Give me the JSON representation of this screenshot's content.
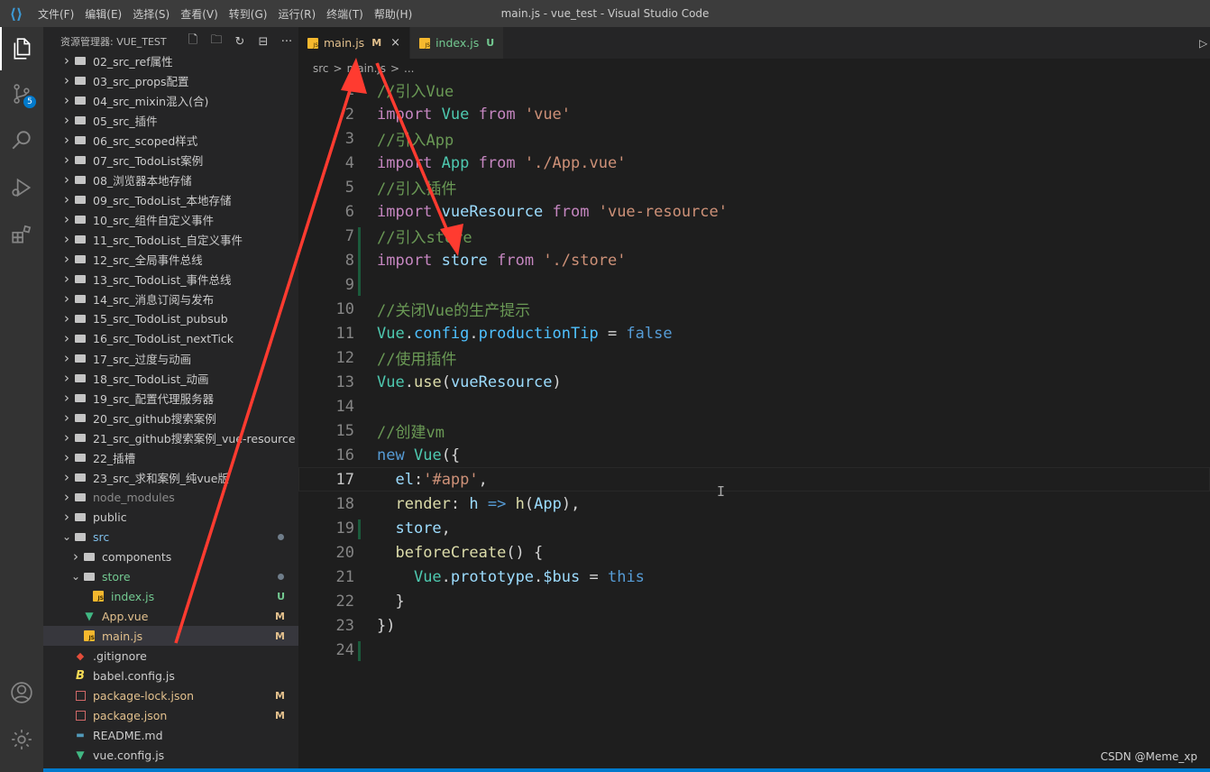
{
  "window": {
    "title": "main.js - vue_test - Visual Studio Code",
    "menu": [
      "文件(F)",
      "编辑(E)",
      "选择(S)",
      "查看(V)",
      "转到(G)",
      "运行(R)",
      "终端(T)",
      "帮助(H)"
    ]
  },
  "activity": {
    "scm_badge": "5",
    "icons": [
      "explorer-icon",
      "source-control-icon",
      "search-icon",
      "run-debug-icon",
      "extensions-icon",
      "account-icon",
      "settings-gear-icon"
    ]
  },
  "sidebar": {
    "title": "资源管理器: VUE_TEST",
    "tools": [
      "new-file-icon",
      "new-folder-icon",
      "refresh-icon",
      "collapse-all-icon",
      "more-icon"
    ],
    "items": [
      {
        "label": "02_src_ref属性",
        "kind": "folder",
        "depth": 0,
        "expanded": false
      },
      {
        "label": "03_src_props配置",
        "kind": "folder",
        "depth": 0,
        "expanded": false
      },
      {
        "label": "04_src_mixin混入(合)",
        "kind": "folder",
        "depth": 0,
        "expanded": false
      },
      {
        "label": "05_src_插件",
        "kind": "folder",
        "depth": 0,
        "expanded": false
      },
      {
        "label": "06_src_scoped样式",
        "kind": "folder",
        "depth": 0,
        "expanded": false
      },
      {
        "label": "07_src_TodoList案例",
        "kind": "folder",
        "depth": 0,
        "expanded": false
      },
      {
        "label": "08_浏览器本地存储",
        "kind": "folder",
        "depth": 0,
        "expanded": false
      },
      {
        "label": "09_src_TodoList_本地存储",
        "kind": "folder",
        "depth": 0,
        "expanded": false
      },
      {
        "label": "10_src_组件自定义事件",
        "kind": "folder",
        "depth": 0,
        "expanded": false
      },
      {
        "label": "11_src_TodoList_自定义事件",
        "kind": "folder",
        "depth": 0,
        "expanded": false
      },
      {
        "label": "12_src_全局事件总线",
        "kind": "folder",
        "depth": 0,
        "expanded": false
      },
      {
        "label": "13_src_TodoList_事件总线",
        "kind": "folder",
        "depth": 0,
        "expanded": false
      },
      {
        "label": "14_src_消息订阅与发布",
        "kind": "folder",
        "depth": 0,
        "expanded": false
      },
      {
        "label": "15_src_TodoList_pubsub",
        "kind": "folder",
        "depth": 0,
        "expanded": false
      },
      {
        "label": "16_src_TodoList_nextTick",
        "kind": "folder",
        "depth": 0,
        "expanded": false
      },
      {
        "label": "17_src_过度与动画",
        "kind": "folder",
        "depth": 0,
        "expanded": false
      },
      {
        "label": "18_src_TodoList_动画",
        "kind": "folder",
        "depth": 0,
        "expanded": false
      },
      {
        "label": "19_src_配置代理服务器",
        "kind": "folder",
        "depth": 0,
        "expanded": false
      },
      {
        "label": "20_src_github搜索案例",
        "kind": "folder",
        "depth": 0,
        "expanded": false
      },
      {
        "label": "21_src_github搜索案例_vue-resource",
        "kind": "folder",
        "depth": 0,
        "expanded": false
      },
      {
        "label": "22_插槽",
        "kind": "folder",
        "depth": 0,
        "expanded": false
      },
      {
        "label": "23_src_求和案例_纯vue版",
        "kind": "folder",
        "depth": 0,
        "expanded": false
      },
      {
        "label": "node_modules",
        "kind": "folder",
        "depth": 0,
        "expanded": false,
        "dim": true
      },
      {
        "label": "public",
        "kind": "folder",
        "depth": 0,
        "expanded": false
      },
      {
        "label": "src",
        "kind": "folder",
        "depth": 0,
        "expanded": true,
        "dot": true,
        "blue": true
      },
      {
        "label": "components",
        "kind": "folder",
        "depth": 1,
        "expanded": false
      },
      {
        "label": "store",
        "kind": "folder",
        "depth": 1,
        "expanded": true,
        "dot": true,
        "new": true
      },
      {
        "label": "index.js",
        "kind": "js",
        "depth": 2,
        "status": "U"
      },
      {
        "label": "App.vue",
        "kind": "vue",
        "depth": 1,
        "status": "M"
      },
      {
        "label": "main.js",
        "kind": "js",
        "depth": 1,
        "status": "M",
        "selected": true
      },
      {
        "label": ".gitignore",
        "kind": "git",
        "depth": 0
      },
      {
        "label": "babel.config.js",
        "kind": "babel",
        "depth": 0
      },
      {
        "label": "package-lock.json",
        "kind": "json",
        "depth": 0,
        "status": "M"
      },
      {
        "label": "package.json",
        "kind": "json",
        "depth": 0,
        "status": "M"
      },
      {
        "label": "README.md",
        "kind": "md",
        "depth": 0
      },
      {
        "label": "vue.config.js",
        "kind": "vue",
        "depth": 0
      }
    ]
  },
  "tabs": [
    {
      "label": "main.js",
      "status": "M",
      "active": true,
      "close": "×"
    },
    {
      "label": "index.js",
      "status": "U",
      "active": false
    }
  ],
  "breadcrumb": [
    "src",
    ">",
    "main.js",
    ">",
    "..."
  ],
  "editor": {
    "current_line": 17,
    "lines": [
      {
        "n": 1,
        "tokens": [
          [
            "cm",
            "//引入Vue"
          ]
        ]
      },
      {
        "n": 2,
        "tokens": [
          [
            "kw",
            "import"
          ],
          [
            "",
            " "
          ],
          [
            "cls",
            "Vue"
          ],
          [
            "",
            " "
          ],
          [
            "kw",
            "from"
          ],
          [
            "",
            " "
          ],
          [
            "str",
            "'vue'"
          ]
        ]
      },
      {
        "n": 3,
        "tokens": [
          [
            "cm",
            "//引入App"
          ]
        ]
      },
      {
        "n": 4,
        "tokens": [
          [
            "kw",
            "import"
          ],
          [
            "",
            " "
          ],
          [
            "cls",
            "App"
          ],
          [
            "",
            " "
          ],
          [
            "kw",
            "from"
          ],
          [
            "",
            " "
          ],
          [
            "str",
            "'./App.vue'"
          ]
        ]
      },
      {
        "n": 5,
        "tokens": [
          [
            "cm",
            "//引入插件"
          ]
        ]
      },
      {
        "n": 6,
        "tokens": [
          [
            "kw",
            "import"
          ],
          [
            "",
            " "
          ],
          [
            "id",
            "vueResource"
          ],
          [
            "",
            " "
          ],
          [
            "kw",
            "from"
          ],
          [
            "",
            " "
          ],
          [
            "str",
            "'vue-resource'"
          ]
        ]
      },
      {
        "n": 7,
        "tokens": [
          [
            "cm",
            "//引入store"
          ]
        ]
      },
      {
        "n": 8,
        "tokens": [
          [
            "kw",
            "import"
          ],
          [
            "",
            " "
          ],
          [
            "id",
            "store"
          ],
          [
            "",
            " "
          ],
          [
            "kw",
            "from"
          ],
          [
            "",
            " "
          ],
          [
            "str",
            "'./store'"
          ]
        ]
      },
      {
        "n": 9,
        "tokens": []
      },
      {
        "n": 10,
        "tokens": [
          [
            "cm",
            "//关闭Vue的生产提示"
          ]
        ]
      },
      {
        "n": 11,
        "tokens": [
          [
            "cls",
            "Vue"
          ],
          [
            "",
            "."
          ],
          [
            "prop",
            "config"
          ],
          [
            "",
            "."
          ],
          [
            "prop",
            "productionTip"
          ],
          [
            "",
            " = "
          ],
          [
            "kw2",
            "false"
          ]
        ]
      },
      {
        "n": 12,
        "tokens": [
          [
            "cm",
            "//使用插件"
          ]
        ]
      },
      {
        "n": 13,
        "tokens": [
          [
            "cls",
            "Vue"
          ],
          [
            "",
            "."
          ],
          [
            "fn",
            "use"
          ],
          [
            "",
            "("
          ],
          [
            "id",
            "vueResource"
          ],
          [
            "",
            ")"
          ]
        ]
      },
      {
        "n": 14,
        "tokens": []
      },
      {
        "n": 15,
        "tokens": [
          [
            "cm",
            "//创建vm"
          ]
        ]
      },
      {
        "n": 16,
        "tokens": [
          [
            "kw2",
            "new"
          ],
          [
            "",
            " "
          ],
          [
            "cls",
            "Vue"
          ],
          [
            "",
            "({"
          ]
        ]
      },
      {
        "n": 17,
        "tokens": [
          [
            "",
            "  "
          ],
          [
            "id",
            "el"
          ],
          [
            "",
            ":"
          ],
          [
            "str",
            "'#app'"
          ],
          [
            "",
            ","
          ]
        ]
      },
      {
        "n": 18,
        "tokens": [
          [
            "",
            "  "
          ],
          [
            "fn",
            "render"
          ],
          [
            "",
            ": "
          ],
          [
            "id",
            "h"
          ],
          [
            "",
            " "
          ],
          [
            "kw2",
            "=>"
          ],
          [
            "",
            " "
          ],
          [
            "fn",
            "h"
          ],
          [
            "",
            "("
          ],
          [
            "id",
            "App"
          ],
          [
            "",
            "),"
          ]
        ]
      },
      {
        "n": 19,
        "tokens": [
          [
            "",
            "  "
          ],
          [
            "id",
            "store"
          ],
          [
            "",
            ","
          ]
        ]
      },
      {
        "n": 20,
        "tokens": [
          [
            "",
            "  "
          ],
          [
            "fn",
            "beforeCreate"
          ],
          [
            "",
            "() {"
          ]
        ]
      },
      {
        "n": 21,
        "tokens": [
          [
            "",
            "    "
          ],
          [
            "cls",
            "Vue"
          ],
          [
            "",
            "."
          ],
          [
            "id",
            "prototype"
          ],
          [
            "",
            "."
          ],
          [
            "id",
            "$bus"
          ],
          [
            "",
            " = "
          ],
          [
            "kw2",
            "this"
          ]
        ]
      },
      {
        "n": 22,
        "tokens": [
          [
            "",
            "  }"
          ]
        ]
      },
      {
        "n": 23,
        "tokens": [
          [
            "",
            "})"
          ]
        ]
      },
      {
        "n": 24,
        "tokens": []
      }
    ]
  },
  "watermark": "CSDN @Meme_xp",
  "colors": {
    "annotation_arrow": "#ff3b30",
    "accent": "#007acc",
    "modified": "#e2c08d",
    "untracked": "#73c991"
  }
}
